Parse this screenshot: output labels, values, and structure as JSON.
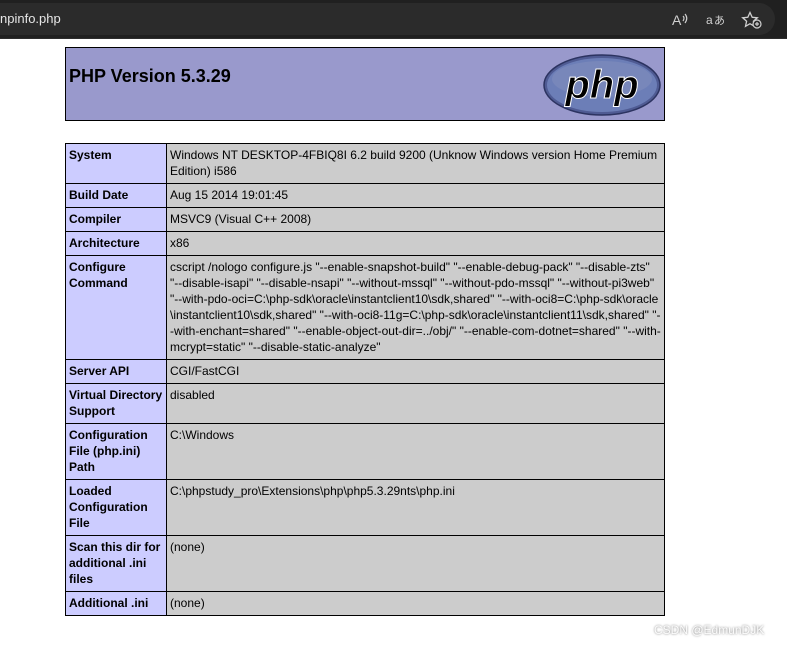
{
  "browser": {
    "url": "npinfo.php",
    "icons": [
      "read-aloud-icon",
      "translate-icon",
      "favorite-add-icon"
    ]
  },
  "header": {
    "title": "PHP Version 5.3.29",
    "logo_text": "php"
  },
  "rows": [
    {
      "key": "System",
      "value": "Windows NT DESKTOP-4FBIQ8I 6.2 build 9200 (Unknow Windows version Home Premium Edition) i586"
    },
    {
      "key": "Build Date",
      "value": "Aug 15 2014 19:01:45"
    },
    {
      "key": "Compiler",
      "value": "MSVC9 (Visual C++ 2008)"
    },
    {
      "key": "Architecture",
      "value": "x86"
    },
    {
      "key": "Configure Command",
      "value": "cscript /nologo configure.js \"--enable-snapshot-build\" \"--enable-debug-pack\" \"--disable-zts\" \"--disable-isapi\" \"--disable-nsapi\" \"--without-mssql\" \"--without-pdo-mssql\" \"--without-pi3web\" \"--with-pdo-oci=C:\\php-sdk\\oracle\\instantclient10\\sdk,shared\" \"--with-oci8=C:\\php-sdk\\oracle\\instantclient10\\sdk,shared\" \"--with-oci8-11g=C:\\php-sdk\\oracle\\instantclient11\\sdk,shared\" \"--with-enchant=shared\" \"--enable-object-out-dir=../obj/\" \"--enable-com-dotnet=shared\" \"--with-mcrypt=static\" \"--disable-static-analyze\""
    },
    {
      "key": "Server API",
      "value": "CGI/FastCGI"
    },
    {
      "key": "Virtual Directory Support",
      "value": "disabled"
    },
    {
      "key": "Configuration File (php.ini) Path",
      "value": "C:\\Windows"
    },
    {
      "key": "Loaded Configuration File",
      "value": "C:\\phpstudy_pro\\Extensions\\php\\php5.3.29nts\\php.ini"
    },
    {
      "key": "Scan this dir for additional .ini files",
      "value": "(none)"
    },
    {
      "key": "Additional .ini",
      "value": "(none)"
    }
  ],
  "watermark": "CSDN @EdmunDJK",
  "colors": {
    "header_bg": "#9999cc",
    "key_bg": "#ccccff",
    "value_bg": "#cccccc",
    "browser_bar": "#202020"
  }
}
